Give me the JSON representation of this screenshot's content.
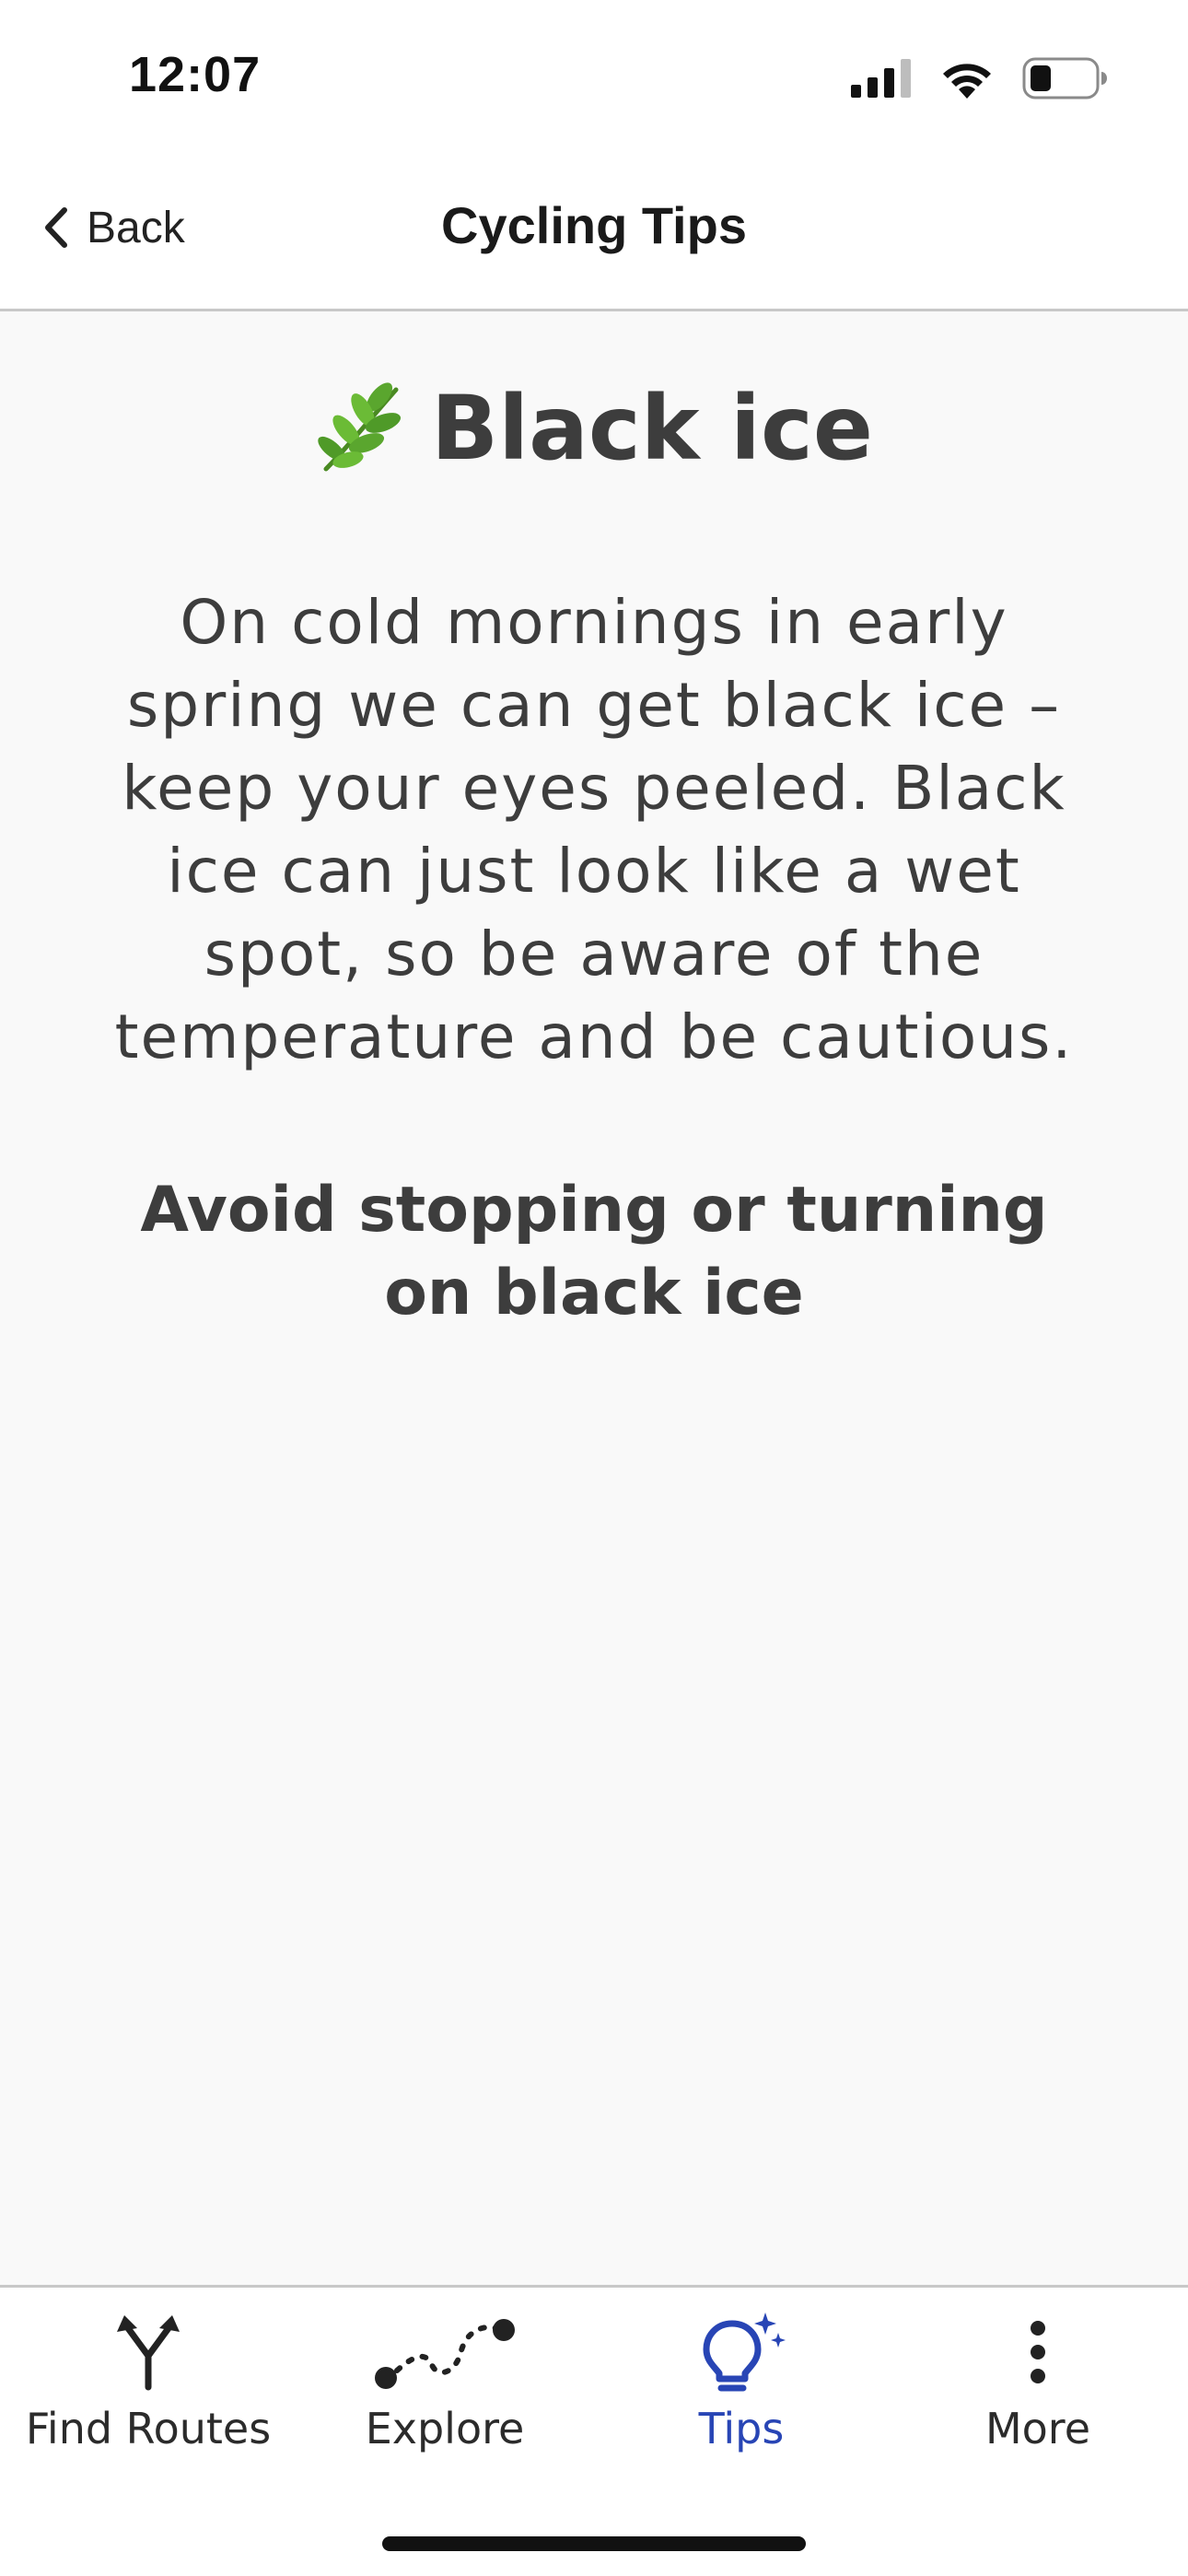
{
  "status_bar": {
    "time": "12:07"
  },
  "nav": {
    "back_label": "Back",
    "title": "Cycling Tips"
  },
  "tip": {
    "icon": "herb-icon",
    "title": "Black ice",
    "body": "On cold mornings in early spring we can get black ice – keep your eyes peeled. Black ice can just look like a wet spot, so be aware of the temperature and be cautious.",
    "warning": "Avoid stopping or turning on black ice"
  },
  "tab_bar": {
    "active_color": "#2845b5",
    "tabs": [
      {
        "label": "Find Routes",
        "icon": "route-split-icon",
        "active": false
      },
      {
        "label": "Explore",
        "icon": "dotted-path-icon",
        "active": false
      },
      {
        "label": "Tips",
        "icon": "lightbulb-sparkle-icon",
        "active": true
      },
      {
        "label": "More",
        "icon": "more-vertical-icon",
        "active": false
      }
    ]
  }
}
